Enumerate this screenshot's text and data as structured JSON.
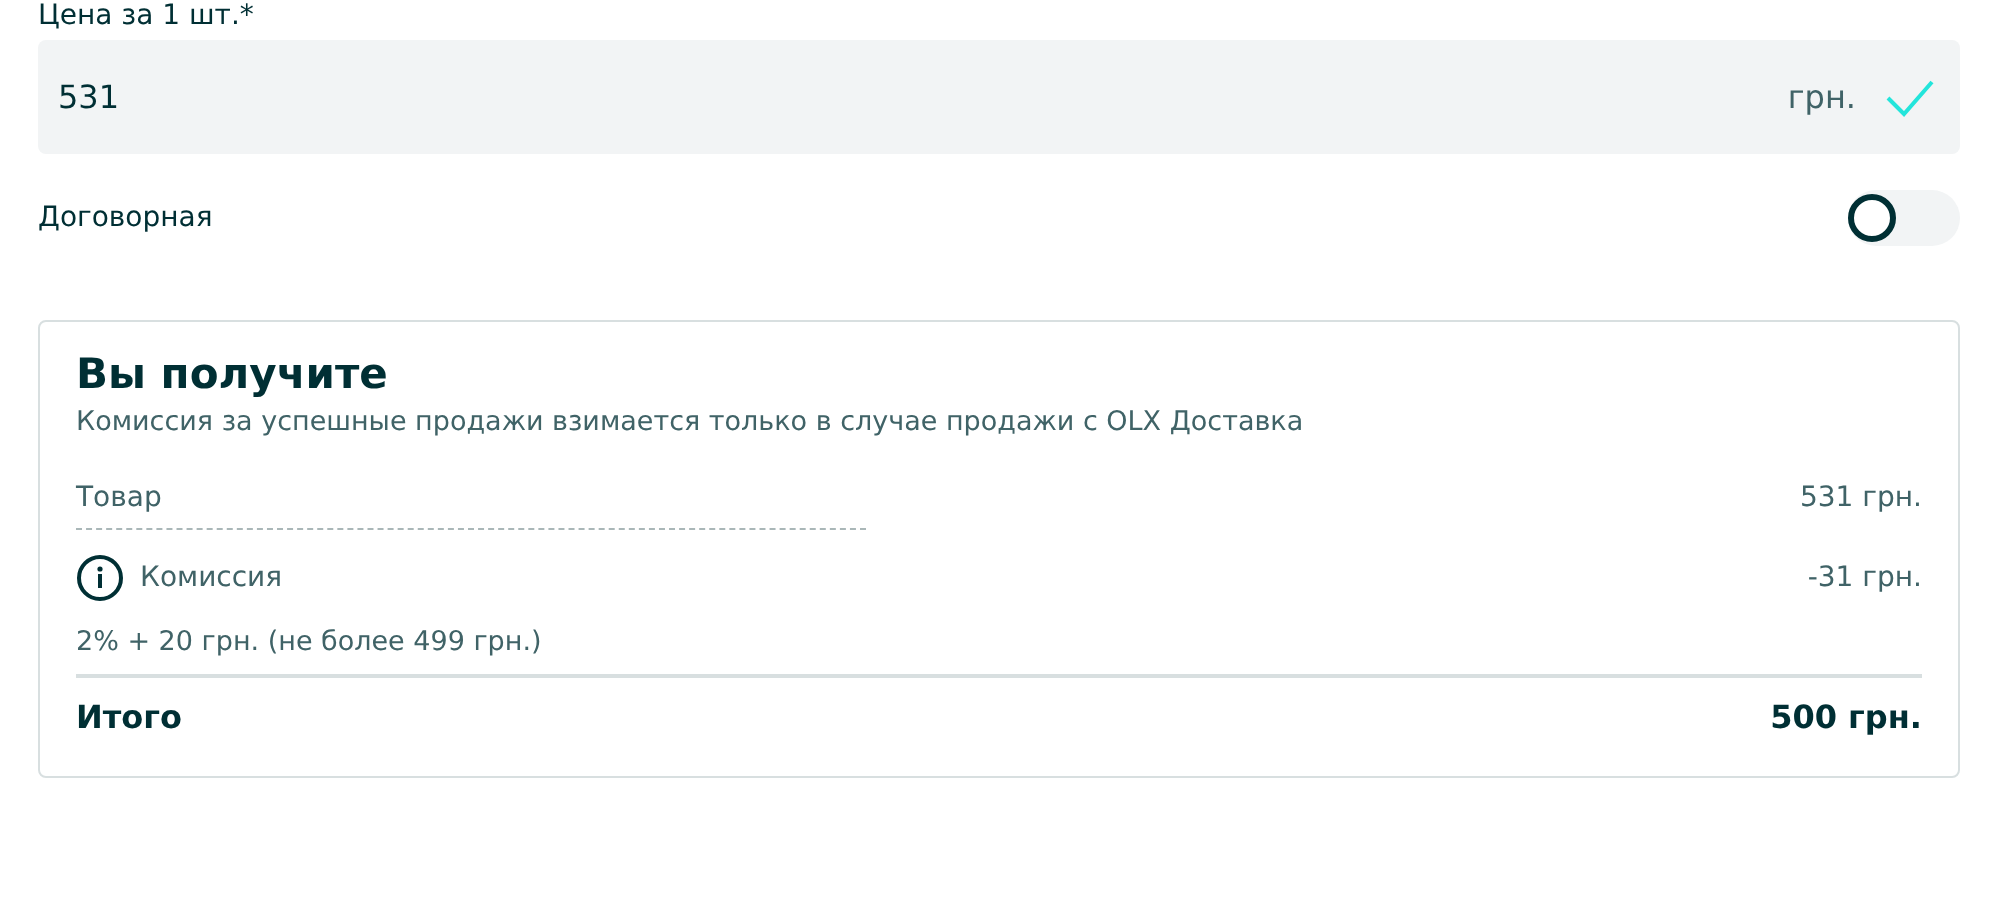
{
  "price": {
    "label": "Цена за 1 шт.*",
    "value": "531",
    "currency": "грн.",
    "valid": true
  },
  "negotiable": {
    "label": "Договорная",
    "on": false
  },
  "summary": {
    "title": "Вы получите",
    "note": "Комиссия за успешные продажи взимается только в случае продажи с OLX Доставка",
    "rows": [
      {
        "kind": "item",
        "label": "Товар",
        "amount": "531 грн."
      },
      {
        "kind": "fee",
        "label": "Комиссия",
        "amount": "-31 грн.",
        "detail": "2% + 20 грн. (не более 499 грн.)"
      }
    ],
    "total": {
      "label": "Итого",
      "amount": "500 грн."
    }
  }
}
